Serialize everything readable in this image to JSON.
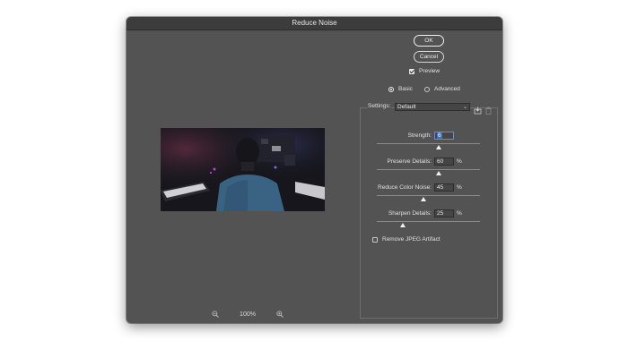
{
  "dialog": {
    "title": "Reduce Noise",
    "ok_label": "OK",
    "cancel_label": "Cancel",
    "preview_label": "Preview",
    "preview_checked": true,
    "mode_basic_label": "Basic",
    "mode_advanced_label": "Advanced",
    "selected_mode": "Basic"
  },
  "settings": {
    "label": "Settings:",
    "preset": "Default",
    "params": [
      {
        "label": "Strength:",
        "value": "6",
        "unit": "",
        "max": 10
      },
      {
        "label": "Preserve Details:",
        "value": "60",
        "unit": "%",
        "max": 100
      },
      {
        "label": "Reduce Color Noise:",
        "value": "45",
        "unit": "%",
        "max": 100
      },
      {
        "label": "Sharpen Details:",
        "value": "25",
        "unit": "%",
        "max": 100
      }
    ],
    "remove_jpeg_label": "Remove JPEG Artifact",
    "remove_jpeg_checked": false
  },
  "zoom": {
    "level": "100%"
  },
  "icons": {
    "zoom_out": "zoom-out-icon",
    "zoom_in": "zoom-in-icon",
    "save_preset": "save-preset-icon",
    "delete_preset": "trash-icon",
    "dropdown": "chevron-down-icon"
  },
  "colors": {
    "dialog_bg": "#535353",
    "titlebar_bg": "#3c3c3c",
    "field_bg": "#454545",
    "focus_highlight": "#3d6fc0"
  }
}
